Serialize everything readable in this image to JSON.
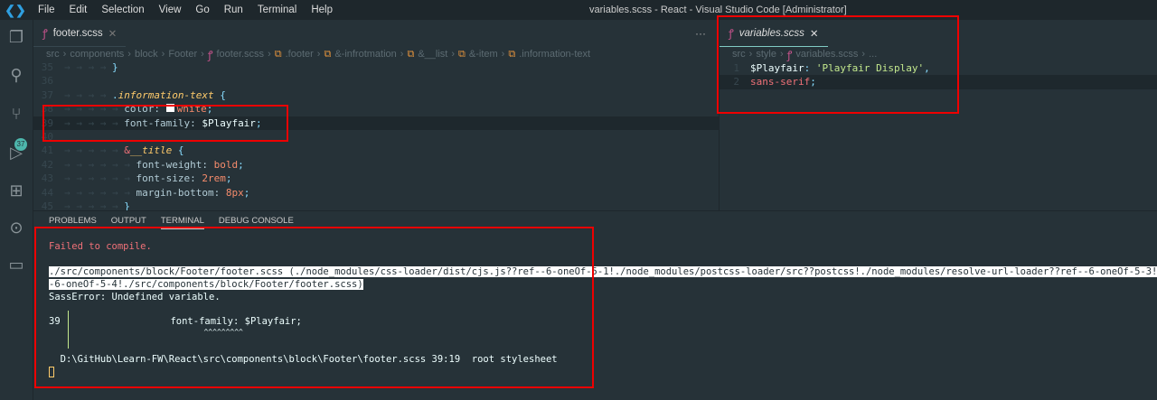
{
  "titlebar": {
    "menu": [
      "File",
      "Edit",
      "Selection",
      "View",
      "Go",
      "Run",
      "Terminal",
      "Help"
    ],
    "title": "variables.scss - React - Visual Studio Code [Administrator]"
  },
  "activity": {
    "scm_badge": "37"
  },
  "editor1": {
    "tab": "footer.scss",
    "more": "···",
    "breadcrumb": [
      "src",
      "components",
      "block",
      "Footer",
      "footer.scss",
      ".footer",
      "&-infrotmation",
      "&__list",
      "&-item",
      ".information-text"
    ],
    "lines": [
      {
        "n": "35",
        "indent": "→ → → → ",
        "parts": [
          [
            "p",
            "}"
          ]
        ]
      },
      {
        "n": "36",
        "indent": "",
        "parts": []
      },
      {
        "n": "37",
        "indent": "→ → → → ",
        "parts": [
          [
            "p",
            "."
          ],
          [
            "sel",
            "information-text"
          ],
          [
            "p",
            " {"
          ]
        ]
      },
      {
        "n": "38",
        "indent": "→ → → → → ",
        "parts": [
          [
            "k",
            "color: "
          ],
          [
            "swatch",
            ""
          ],
          [
            "v",
            "white"
          ],
          [
            "p",
            ";"
          ]
        ]
      },
      {
        "n": "39",
        "indent": "→ → → → → ",
        "parts": [
          [
            "k",
            "font-family: "
          ],
          [
            "var",
            "$Playfair"
          ],
          [
            "p",
            ";"
          ]
        ]
      },
      {
        "n": "40",
        "indent": "",
        "parts": []
      },
      {
        "n": "41",
        "indent": "→ → → → → ",
        "parts": [
          [
            "sel2",
            "&"
          ],
          [
            "sel",
            "__title"
          ],
          [
            "p",
            " {"
          ]
        ]
      },
      {
        "n": "42",
        "indent": "→ → → → → → ",
        "parts": [
          [
            "k",
            "font-weight: "
          ],
          [
            "v",
            "bold"
          ],
          [
            "p",
            ";"
          ]
        ]
      },
      {
        "n": "43",
        "indent": "→ → → → → → ",
        "parts": [
          [
            "k",
            "font-size: "
          ],
          [
            "v",
            "2rem"
          ],
          [
            "p",
            ";"
          ]
        ]
      },
      {
        "n": "44",
        "indent": "→ → → → → → ",
        "parts": [
          [
            "k",
            "margin-bottom: "
          ],
          [
            "v",
            "8px"
          ],
          [
            "p",
            ";"
          ]
        ]
      },
      {
        "n": "45",
        "indent": "→ → → → → ",
        "parts": [
          [
            "p",
            "}"
          ]
        ]
      }
    ]
  },
  "editor2": {
    "tab": "variables.scss",
    "breadcrumb": [
      "src",
      "style",
      "variables.scss",
      "..."
    ],
    "lines": [
      {
        "n": "1",
        "indent": "",
        "parts": [
          [
            "var",
            "$Playfair"
          ],
          [
            "p",
            ": "
          ],
          [
            "str",
            "'Playfair Display'"
          ],
          [
            "p",
            ","
          ]
        ]
      },
      {
        "n": "2",
        "indent": "",
        "parts": [
          [
            "sel2",
            "sans-serif"
          ],
          [
            "p",
            ";"
          ]
        ]
      }
    ]
  },
  "panel": {
    "tabs": [
      "PROBLEMS",
      "OUTPUT",
      "TERMINAL",
      "DEBUG CONSOLE"
    ],
    "active_tab": "TERMINAL",
    "terminal": {
      "error_title": "Failed to compile.",
      "path_line1": "./src/components/block/Footer/footer.scss (./node_modules/css-loader/dist/cjs.js??ref--6-oneOf-5-1!./node_modules/postcss-loader/src??postcss!./node_modules/resolve-url-loader??ref--6-oneOf-5-3!./no",
      "path_line2": "-6-oneOf-5-4!./src/components/block/Footer/footer.scss)",
      "sass_error": "SassError: Undefined variable.",
      "line_no": "39",
      "source_line": "                 font-family: $Playfair;",
      "carets": "                              ^^^^^^^^^",
      "location": "  D:\\GitHub\\Learn-FW\\React\\src\\components\\block\\Footer\\footer.scss 39:19  root stylesheet"
    }
  },
  "colors": {
    "highlight_box": "#e00000",
    "error": "#f07178",
    "background": "#263238"
  }
}
